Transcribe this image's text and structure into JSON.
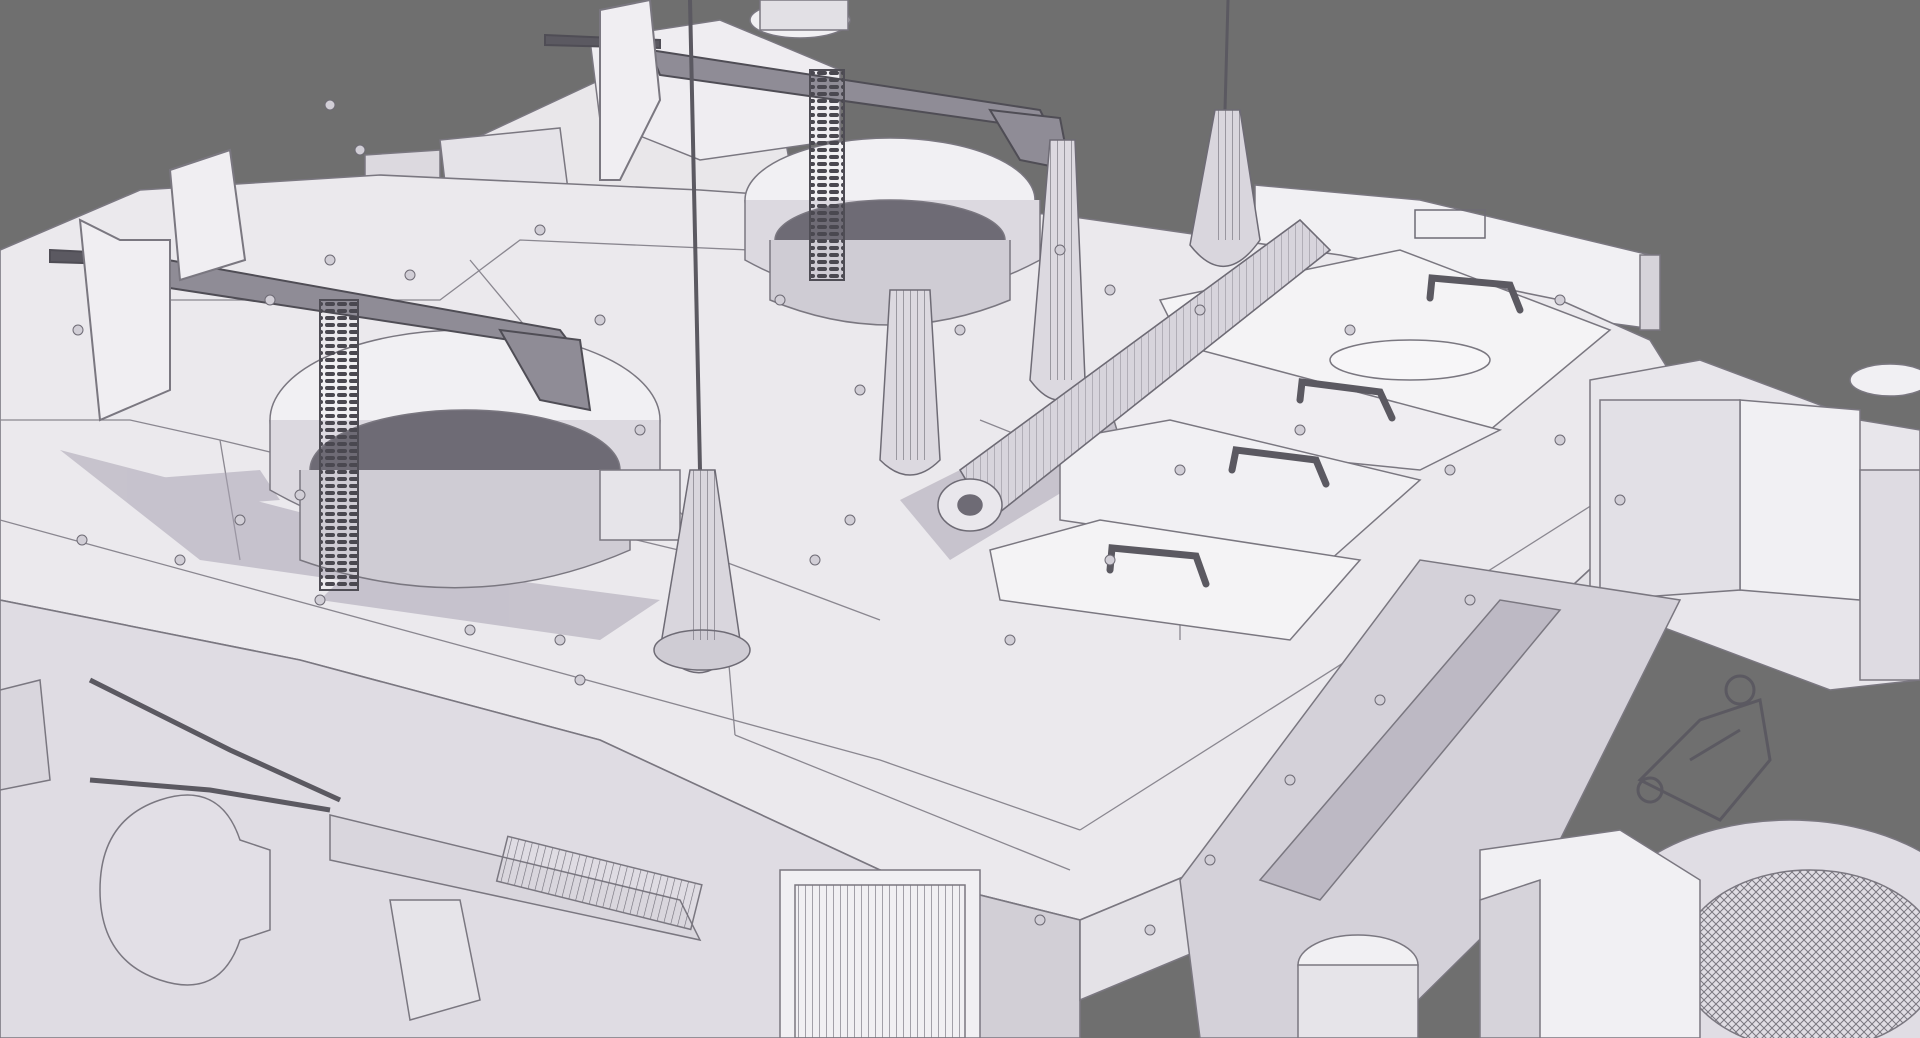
{
  "scene": {
    "subject": "tank-turret-model",
    "colors": {
      "background": "#6f6f6f",
      "hull": "#e9e7ea",
      "hull_light": "#f4f3f5",
      "hull_shade": "#cfccd2",
      "shadow": "#a9a4b3",
      "line": "#7a7780",
      "metal_dark": "#5b5961"
    }
  }
}
